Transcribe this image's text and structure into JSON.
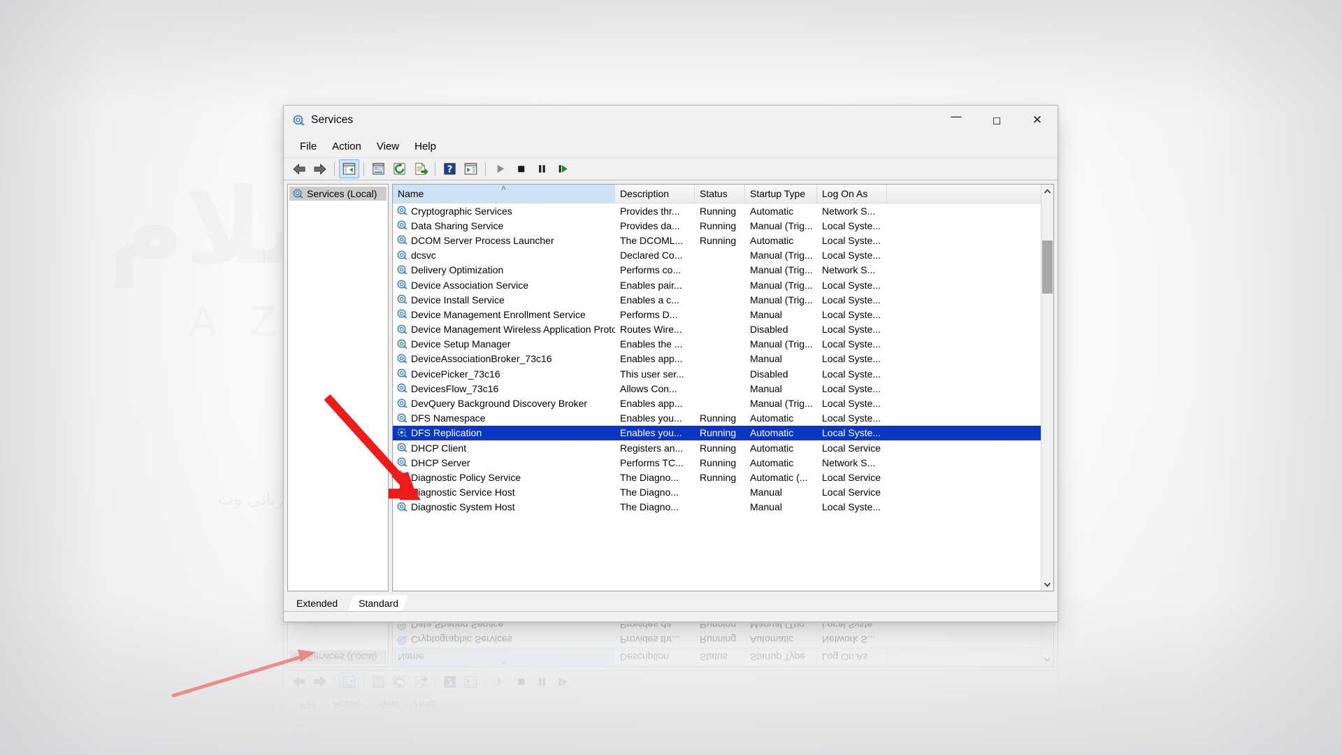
{
  "window": {
    "title": "Services",
    "title_icon": "services-gear-icon",
    "controls": {
      "minimize": "–",
      "maximize": "☐",
      "close": "✕"
    }
  },
  "menu": {
    "items": [
      {
        "label": "File"
      },
      {
        "label": "Action"
      },
      {
        "label": "View"
      },
      {
        "label": "Help"
      }
    ]
  },
  "toolbar": {
    "buttons": [
      {
        "name": "back-icon",
        "tooltip": "Back"
      },
      {
        "name": "forward-icon",
        "tooltip": "Forward"
      },
      {
        "name": "show-hide-tree-icon",
        "tooltip": "Show/Hide Console Tree"
      },
      {
        "name": "properties-icon",
        "tooltip": "Properties"
      },
      {
        "name": "refresh-icon",
        "tooltip": "Refresh"
      },
      {
        "name": "export-list-icon",
        "tooltip": "Export List"
      },
      {
        "name": "help-icon",
        "tooltip": "Help"
      },
      {
        "name": "show-action-pane-icon",
        "tooltip": "Show/Hide Action Pane"
      },
      {
        "name": "start-service-icon",
        "tooltip": "Start Service"
      },
      {
        "name": "stop-service-icon",
        "tooltip": "Stop Service"
      },
      {
        "name": "pause-service-icon",
        "tooltip": "Pause Service"
      },
      {
        "name": "restart-service-icon",
        "tooltip": "Restart Service"
      }
    ]
  },
  "tree": {
    "root_label": "Services (Local)",
    "root_icon": "services-gear-icon"
  },
  "list": {
    "columns": [
      {
        "key": "name",
        "label": "Name",
        "sorted": true,
        "sort_arrow": "˄"
      },
      {
        "key": "desc",
        "label": "Description",
        "sorted": false
      },
      {
        "key": "status",
        "label": "Status",
        "sorted": false
      },
      {
        "key": "startup",
        "label": "Startup Type",
        "sorted": false
      },
      {
        "key": "logon",
        "label": "Log On As",
        "sorted": false
      }
    ],
    "rows": [
      {
        "name": "Cryptographic Services",
        "desc": "Provides thr...",
        "status": "Running",
        "startup": "Automatic",
        "logon": "Network S...",
        "selected": false
      },
      {
        "name": "Data Sharing Service",
        "desc": "Provides da...",
        "status": "Running",
        "startup": "Manual (Trig...",
        "logon": "Local Syste...",
        "selected": false
      },
      {
        "name": "DCOM Server Process Launcher",
        "desc": "The DCOML...",
        "status": "Running",
        "startup": "Automatic",
        "logon": "Local Syste...",
        "selected": false
      },
      {
        "name": "dcsvc",
        "desc": "Declared Co...",
        "status": "",
        "startup": "Manual (Trig...",
        "logon": "Local Syste...",
        "selected": false
      },
      {
        "name": "Delivery Optimization",
        "desc": "Performs co...",
        "status": "",
        "startup": "Manual (Trig...",
        "logon": "Network S...",
        "selected": false
      },
      {
        "name": "Device Association Service",
        "desc": "Enables pair...",
        "status": "",
        "startup": "Manual (Trig...",
        "logon": "Local Syste...",
        "selected": false
      },
      {
        "name": "Device Install Service",
        "desc": "Enables a c...",
        "status": "",
        "startup": "Manual (Trig...",
        "logon": "Local Syste...",
        "selected": false
      },
      {
        "name": "Device Management Enrollment Service",
        "desc": "Performs D...",
        "status": "",
        "startup": "Manual",
        "logon": "Local Syste...",
        "selected": false
      },
      {
        "name": "Device Management Wireless Application Proto...",
        "desc": "Routes Wire...",
        "status": "",
        "startup": "Disabled",
        "logon": "Local Syste...",
        "selected": false
      },
      {
        "name": "Device Setup Manager",
        "desc": "Enables the ...",
        "status": "",
        "startup": "Manual (Trig...",
        "logon": "Local Syste...",
        "selected": false
      },
      {
        "name": "DeviceAssociationBroker_73c16",
        "desc": "Enables app...",
        "status": "",
        "startup": "Manual",
        "logon": "Local Syste...",
        "selected": false
      },
      {
        "name": "DevicePicker_73c16",
        "desc": "This user ser...",
        "status": "",
        "startup": "Disabled",
        "logon": "Local Syste...",
        "selected": false
      },
      {
        "name": "DevicesFlow_73c16",
        "desc": "Allows Con...",
        "status": "",
        "startup": "Manual",
        "logon": "Local Syste...",
        "selected": false
      },
      {
        "name": "DevQuery Background Discovery Broker",
        "desc": "Enables app...",
        "status": "",
        "startup": "Manual (Trig...",
        "logon": "Local Syste...",
        "selected": false
      },
      {
        "name": "DFS Namespace",
        "desc": "Enables you...",
        "status": "Running",
        "startup": "Automatic",
        "logon": "Local Syste...",
        "selected": false
      },
      {
        "name": "DFS Replication",
        "desc": "Enables you...",
        "status": "Running",
        "startup": "Automatic",
        "logon": "Local Syste...",
        "selected": true
      },
      {
        "name": "DHCP Client",
        "desc": "Registers an...",
        "status": "Running",
        "startup": "Automatic",
        "logon": "Local Service",
        "selected": false
      },
      {
        "name": "DHCP Server",
        "desc": "Performs TC...",
        "status": "Running",
        "startup": "Automatic",
        "logon": "Network S...",
        "selected": false
      },
      {
        "name": "Diagnostic Policy Service",
        "desc": "The Diagno...",
        "status": "Running",
        "startup": "Automatic (...",
        "logon": "Local Service",
        "selected": false
      },
      {
        "name": "Diagnostic Service Host",
        "desc": "The Diagno...",
        "status": "",
        "startup": "Manual",
        "logon": "Local Service",
        "selected": false
      },
      {
        "name": "Diagnostic System Host",
        "desc": "The Diagno...",
        "status": "",
        "startup": "Manual",
        "logon": "Local Syste...",
        "selected": false
      }
    ],
    "row_icon": "service-gear-icon",
    "selection_color": "#0a36c4",
    "header_sorted_color": "#cbe3f5"
  },
  "scrollbar": {
    "up_arrow": "▲",
    "down_arrow": "▼",
    "thumb_position_percent": 12
  },
  "tabs": [
    {
      "label": "Extended",
      "active": false
    },
    {
      "label": "Standard",
      "active": true
    }
  ],
  "annotation": {
    "arrow_color": "#ee1b1b",
    "points_to": "DFS Replication"
  },
  "watermark": {
    "main": "سلام",
    "sub": "A  Z",
    "tag": "ميزبانی وب"
  }
}
